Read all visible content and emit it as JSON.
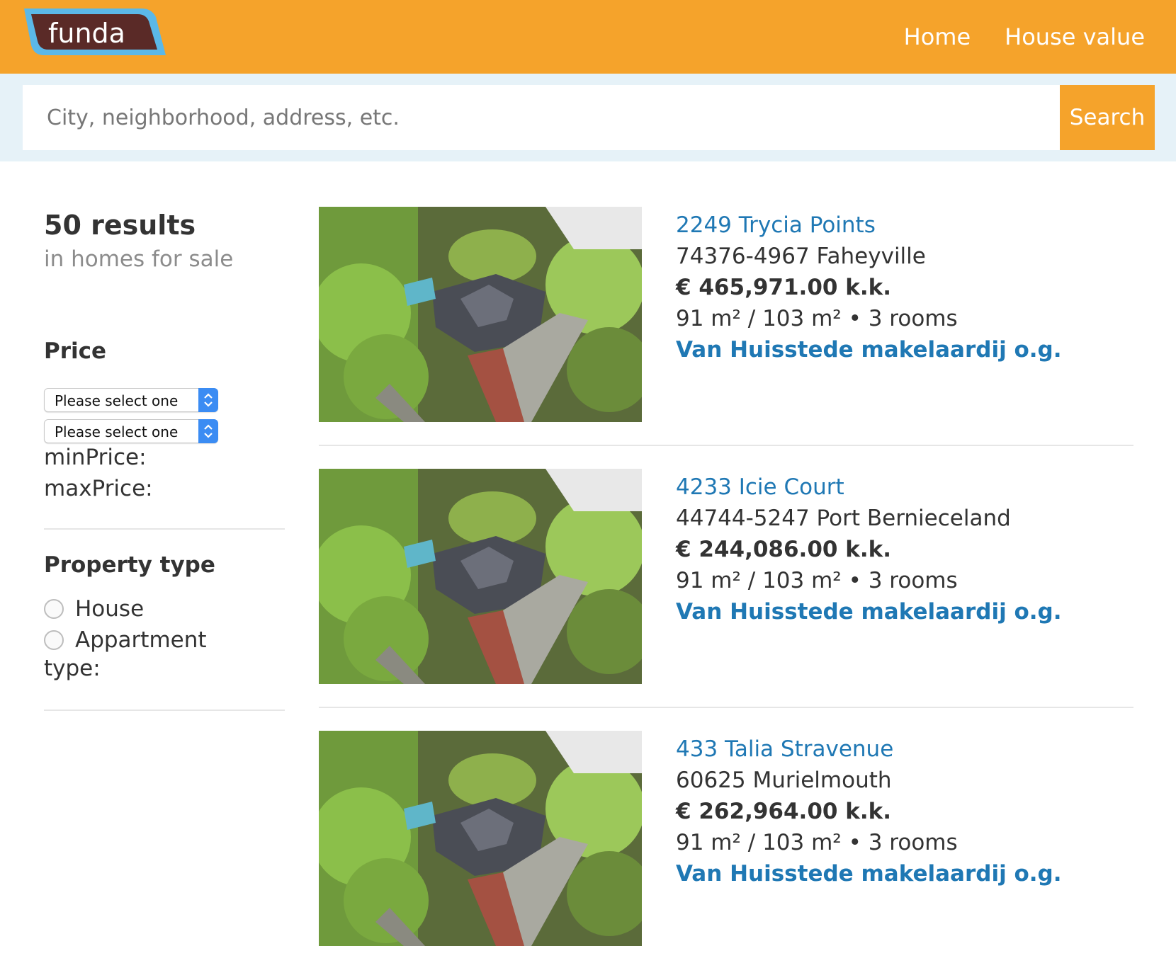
{
  "brand": {
    "logo_text": "funda",
    "accent": "#f5a32b",
    "logo_dark": "#5a2a27",
    "logo_border": "#5bb8e8"
  },
  "nav": {
    "items": [
      "Home",
      "House value"
    ]
  },
  "search": {
    "placeholder": "City, neighborhood, address, etc.",
    "value": "",
    "button_label": "Search"
  },
  "sidebar": {
    "results_count": "50 results",
    "results_context": "in homes for sale",
    "price": {
      "title": "Price",
      "min_select": "Please select one",
      "max_select": "Please select one",
      "min_label": "minPrice:",
      "max_label": "maxPrice:"
    },
    "property_type": {
      "title": "Property type",
      "options": [
        "House",
        "Appartment"
      ],
      "label": "type:"
    }
  },
  "listings": [
    {
      "street": "2249 Trycia Points",
      "city": "74376-4967 Faheyville",
      "price": "€ 465,971.00 k.k.",
      "specs": "91 m² / 103 m² • 3 rooms",
      "agent": "Van Huisstede makelaardij o.g."
    },
    {
      "street": "4233 Icie Court",
      "city": "44744-5247 Port Bernieceland",
      "price": "€ 244,086.00 k.k.",
      "specs": "91 m² / 103 m² • 3 rooms",
      "agent": "Van Huisstede makelaardij o.g."
    },
    {
      "street": "433 Talia Stravenue",
      "city": "60625 Murielmouth",
      "price": "€ 262,964.00 k.k.",
      "specs": "91 m² / 103 m² • 3 rooms",
      "agent": "Van Huisstede makelaardij o.g."
    }
  ]
}
